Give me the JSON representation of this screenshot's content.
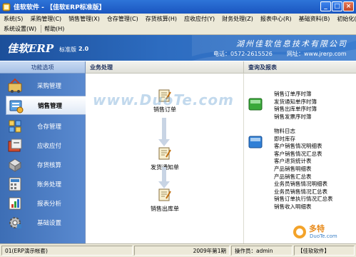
{
  "window": {
    "title": "佳软软件 - 【佳软ERP标准版】",
    "buttons": {
      "minimize": "_",
      "maximize": "□",
      "close": "×"
    }
  },
  "menu": {
    "row1": [
      "系统(S)",
      "采购管理(C)",
      "销售管理(X)",
      "仓存管理(C)",
      "存货核算(H)",
      "应收应付(Y)",
      "财务处理(Z)",
      "报表中心(R)",
      "基础资料(B)",
      "初始化(I)"
    ],
    "row2": [
      "系统设置(W)",
      "帮助(H)"
    ]
  },
  "banner": {
    "product": "佳软ERP",
    "edition": "标准版",
    "version": "2.0",
    "company": "湖州佳软信息技术有限公司",
    "phone": "电话：0572-2615526",
    "website": "网址：www.jrerp.com"
  },
  "sidebar": {
    "header": "功能选项",
    "items": [
      {
        "label": "采购管理",
        "icon": "purchase-icon",
        "active": false
      },
      {
        "label": "销售管理",
        "icon": "sales-icon",
        "active": true
      },
      {
        "label": "仓存管理",
        "icon": "warehouse-icon",
        "active": false
      },
      {
        "label": "应收应付",
        "icon": "receivable-icon",
        "active": false
      },
      {
        "label": "存货核算",
        "icon": "inventory-icon",
        "active": false
      },
      {
        "label": "账务处理",
        "icon": "accounting-icon",
        "active": false
      },
      {
        "label": "报表分析",
        "icon": "report-icon",
        "active": false
      },
      {
        "label": "基础设置",
        "icon": "settings-icon",
        "active": false
      }
    ]
  },
  "main": {
    "business_header": "业务处理",
    "query_header": "查询及报表",
    "flow": [
      {
        "label": "销售订单",
        "icon": "sales-order-icon"
      },
      {
        "label": "发货通知单",
        "icon": "delivery-notice-icon"
      },
      {
        "label": "销售出库单",
        "icon": "sales-outbound-icon"
      }
    ],
    "report_groups": [
      {
        "icon": "book-green-icon",
        "color": "#3aa83a",
        "items": [
          "销售订单序时簿",
          "发货通知单序时簿",
          "销售出库单序时簿",
          "销售发票序时簿"
        ]
      },
      {
        "icon": "book-blue-icon",
        "color": "#2f7fd6",
        "items": [
          "物料日志",
          "即时库存",
          "客户销售情况明细表",
          "客户销售情况汇总表",
          "客户退货统计表",
          "产品销售明细表",
          "产品销售汇总表",
          "业务员销售情况明细表",
          "业务员销售情况汇总表",
          "销售订单执行情况汇总表",
          "销售收入明细表"
        ]
      }
    ]
  },
  "watermark": "www.DuoTe.com",
  "corner_logo": {
    "text1": "多特",
    "text2": "DuoTe.com"
  },
  "status": {
    "account": "01(ERP演示帐套)",
    "period": "2009年第1期",
    "operator": "操作员：admin",
    "brand": "【佳软软件】"
  }
}
